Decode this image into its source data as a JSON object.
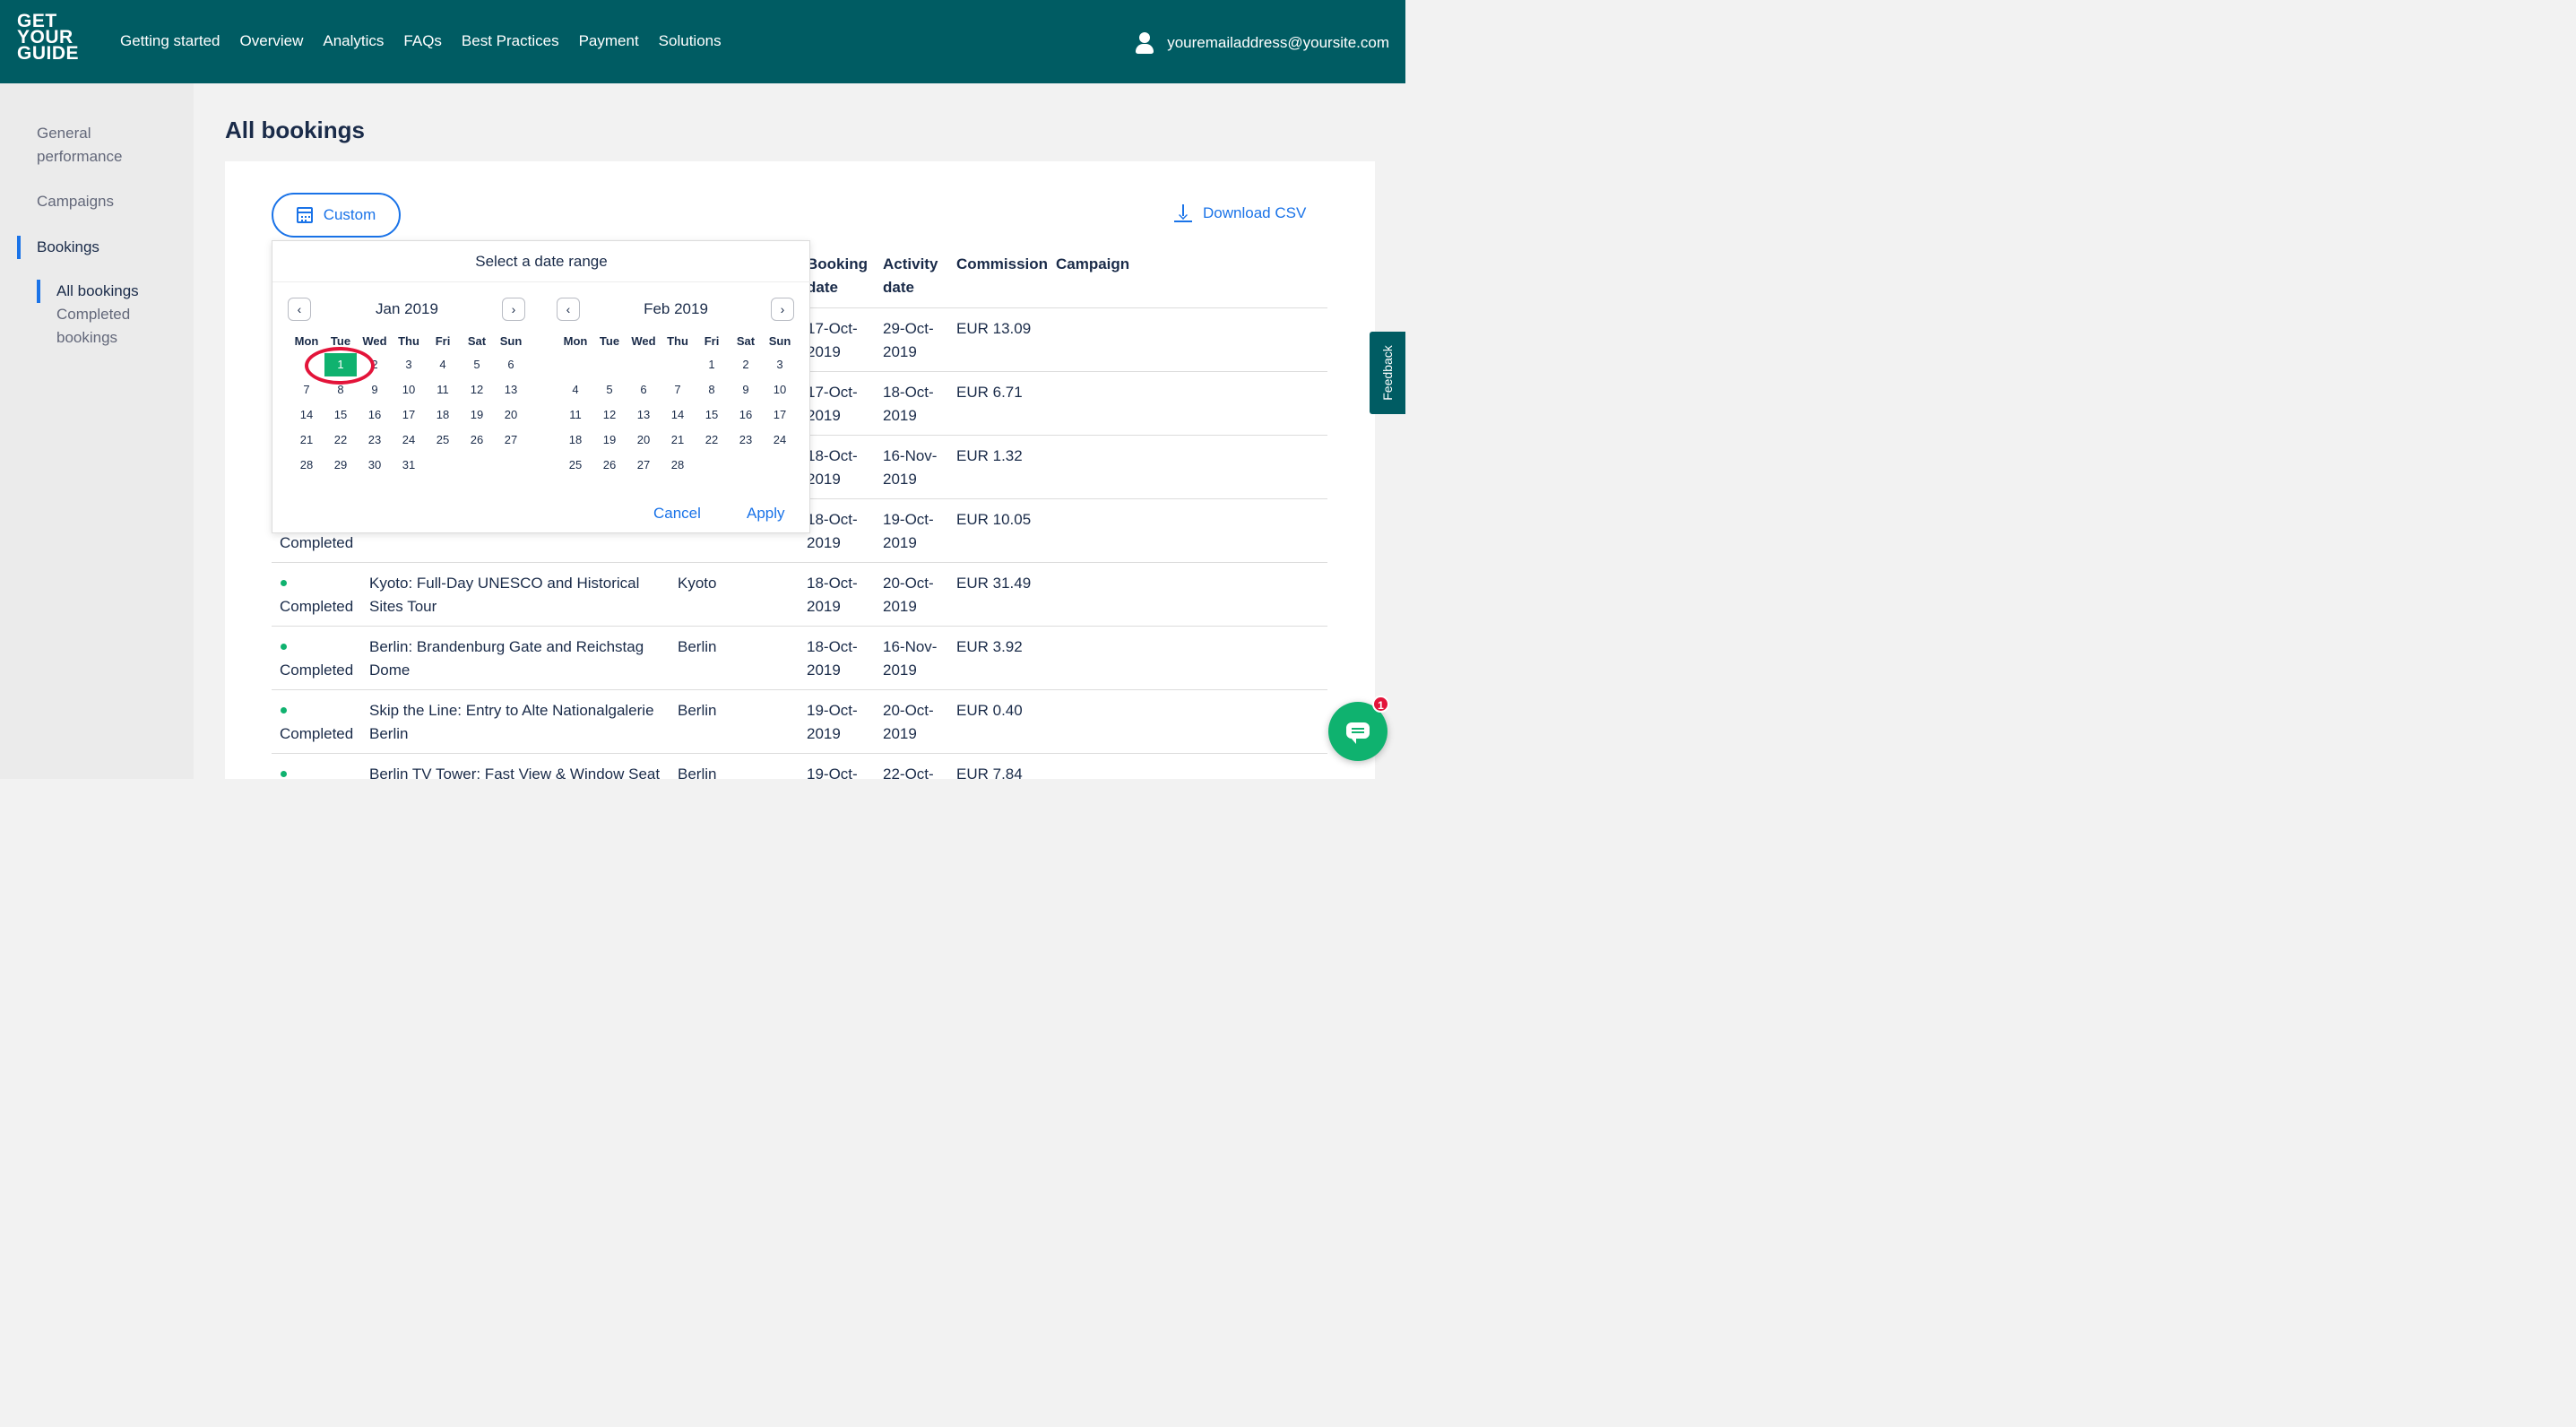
{
  "brand": {
    "logo_line1": "GET",
    "logo_line2": "YOUR",
    "logo_line3": "GUIDE"
  },
  "nav": [
    "Getting started",
    "Overview",
    "Analytics",
    "FAQs",
    "Best Practices",
    "Payment",
    "Solutions"
  ],
  "user": {
    "email": "youremailaddress@yoursite.com"
  },
  "sidebar": {
    "general_performance": "General performance",
    "campaigns": "Campaigns",
    "bookings": "Bookings",
    "sub_all": "All bookings",
    "sub_completed": "Completed bookings"
  },
  "page": {
    "title": "All bookings"
  },
  "toolbar": {
    "custom_label": "Custom",
    "download_label": "Download CSV"
  },
  "table": {
    "headers": {
      "booking_date": "Booking date",
      "activity_date": "Activity date",
      "commission": "Commission",
      "campaign": "Campaign"
    },
    "rows": [
      {
        "status": "",
        "activity": "",
        "city": "",
        "booking": "17-Oct-2019",
        "activity_date": "29-Oct-2019",
        "commission": "EUR 13.09"
      },
      {
        "status": "",
        "activity": "",
        "city": "",
        "booking": "17-Oct-2019",
        "activity_date": "18-Oct-2019",
        "commission": "EUR 6.71"
      },
      {
        "status": "",
        "activity": "",
        "city": "",
        "booking": "18-Oct-2019",
        "activity_date": "16-Nov-2019",
        "commission": "EUR 1.32"
      },
      {
        "status": "Completed",
        "activity": "",
        "city": "",
        "booking": "18-Oct-2019",
        "activity_date": "19-Oct-2019",
        "commission": "EUR 10.05"
      },
      {
        "status": "Completed",
        "activity": "Kyoto: Full-Day UNESCO and Historical Sites Tour",
        "city": "Kyoto",
        "booking": "18-Oct-2019",
        "activity_date": "20-Oct-2019",
        "commission": "EUR 31.49"
      },
      {
        "status": "Completed",
        "activity": "Berlin: Brandenburg Gate and Reichstag Dome",
        "city": "Berlin",
        "booking": "18-Oct-2019",
        "activity_date": "16-Nov-2019",
        "commission": "EUR 3.92"
      },
      {
        "status": "Completed",
        "activity": "Skip the Line: Entry to Alte Nationalgalerie Berlin",
        "city": "Berlin",
        "booking": "19-Oct-2019",
        "activity_date": "20-Oct-2019",
        "commission": "EUR 0.40"
      },
      {
        "status": "",
        "activity": "Berlin TV Tower: Fast View & Window Seat",
        "city": "Berlin",
        "booking": "19-Oct-",
        "activity_date": "22-Oct-",
        "commission": "EUR 7.84"
      }
    ]
  },
  "datepicker": {
    "title": "Select a date range",
    "weekdays": [
      "Mon",
      "Tue",
      "Wed",
      "Thu",
      "Fri",
      "Sat",
      "Sun"
    ],
    "months": [
      {
        "label": "Jan 2019",
        "offset": 1,
        "days": 31,
        "selected": 1
      },
      {
        "label": "Feb 2019",
        "offset": 4,
        "days": 28,
        "selected": null
      }
    ],
    "prev": "‹",
    "next": "›",
    "cancel": "Cancel",
    "apply": "Apply"
  },
  "feedback": "Feedback",
  "chat": {
    "badge": "1"
  },
  "colors": {
    "brand": "#005c63",
    "accent": "#1a73e8",
    "success": "#0fb26f",
    "alert": "#e3143a"
  }
}
